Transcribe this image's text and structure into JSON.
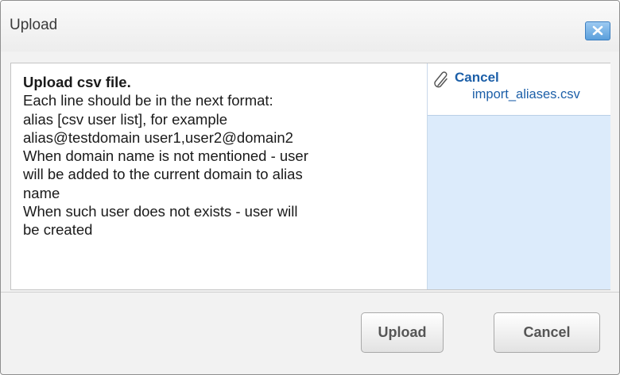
{
  "dialog": {
    "title": "Upload",
    "close_icon": "close-x-icon"
  },
  "instructions": {
    "heading": "Upload csv file.",
    "lines": [
      "Each line should be in the next format:",
      "alias [csv user list], for example",
      "alias@testdomain user1,user2@domain2",
      "When domain name is not mentioned - user",
      "will be added to the current domain to alias",
      "name",
      "When such user does not exists - user will",
      "be created"
    ]
  },
  "file_panel": {
    "icon": "paperclip-icon",
    "cancel_label": "Cancel",
    "file_name": "import_aliases.csv"
  },
  "footer": {
    "upload_label": "Upload",
    "cancel_label": "Cancel"
  },
  "colors": {
    "accent": "#1c5fa8",
    "close_button": "#5a9fdc",
    "file_panel_bg": "#dcebfb"
  }
}
